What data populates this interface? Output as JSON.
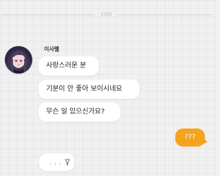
{
  "divider": {
    "label": "END"
  },
  "sender": {
    "name": "이사벨"
  },
  "messages": [
    {
      "from": "이사벨",
      "text": "사랑스러운 분"
    },
    {
      "from": "이사벨",
      "text": "기분이 안 좋아 보이시네요"
    },
    {
      "from": "이사벨",
      "text": "무슨 일 있으신가요?"
    }
  ],
  "my_message": {
    "text": "???"
  },
  "typing": {
    "text": ". . ."
  },
  "colors": {
    "my_bubble": "#f7a31c",
    "their_bubble": "#ffffff",
    "background": "#f1f1f1"
  },
  "icons": {
    "avatar": "avatar-icon",
    "typing_pen": "pen-icon"
  }
}
